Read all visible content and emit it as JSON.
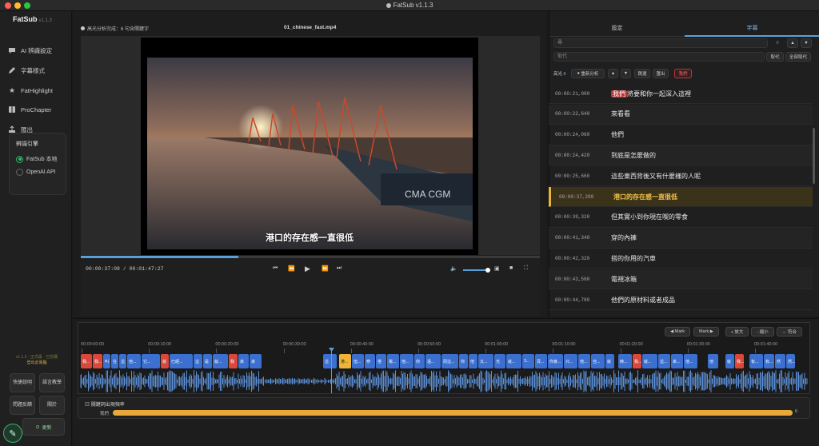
{
  "window": {
    "title": "FatSub v1.1.3"
  },
  "sidebar": {
    "app_name": "FatSub",
    "app_version": "v1.1.3",
    "items": [
      {
        "label": "AI 辨識設定",
        "icon": "chat-icon"
      },
      {
        "label": "字幕樣式",
        "icon": "pen-icon"
      },
      {
        "label": "FatHighlight",
        "icon": "star-icon"
      },
      {
        "label": "ProChapter",
        "icon": "book-icon"
      },
      {
        "label": "匯出",
        "icon": "export-icon"
      }
    ],
    "engine": {
      "heading": "辨識引擎",
      "options": [
        {
          "label": "FatSub 本地",
          "selected": true
        },
        {
          "label": "OpenAI API",
          "selected": false
        }
      ]
    },
    "version_line1": "v1.1.3 · 正式版 · 已授權",
    "version_line2": "登出此電腦",
    "buttons": [
      "快捷說明",
      "語言教學",
      "問題反饋",
      "關於"
    ],
    "update_label": "更新"
  },
  "video": {
    "status": "高光分析完成：6 句含關鍵字",
    "filename": "01_chinese_fast.mp4",
    "subtitle": "港口的存在感一直很低",
    "time_display": "00:00:37:08 / 00:01:47:27",
    "progress": 0.344,
    "volume": 0.9
  },
  "right_panel": {
    "tabs": [
      {
        "label": "設定",
        "active": false
      },
      {
        "label": "字幕",
        "active": true
      }
    ],
    "find_placeholder": "尋",
    "replace_placeholder": "取代",
    "match_count": "0",
    "replace_label": "取代",
    "replace_all_label": "全部取代",
    "highlight_label": "高光",
    "highlight_count": "6",
    "reanalyze_label": "重新分析",
    "prev_label": "▲",
    "next_label": "▼",
    "jump_label": "跳選",
    "exit_label": "匯出",
    "keyword_chip": "我們",
    "rows": [
      {
        "time": "00:00:21,000",
        "pre": "",
        "keyword": "我們",
        "text": "將要和你一起深入這裡",
        "active": false
      },
      {
        "time": "00:00:22,640",
        "pre": "",
        "keyword": "",
        "text": "來看看",
        "active": false
      },
      {
        "time": "00:00:24,060",
        "pre": "",
        "keyword": "",
        "text": "他們",
        "active": false
      },
      {
        "time": "00:00:24,420",
        "pre": "",
        "keyword": "",
        "text": "到底是怎麼做的",
        "active": false
      },
      {
        "time": "00:00:25,660",
        "pre": "",
        "keyword": "",
        "text": "這些東西背後又有什麼樣的人呢",
        "active": false
      },
      {
        "time": "00:00:37,280",
        "pre": "",
        "keyword": "",
        "text": "港口的存在感一直很低",
        "active": true
      },
      {
        "time": "00:00:39,320",
        "pre": "",
        "keyword": "",
        "text": "但其實小到你現在喫的零食",
        "active": false
      },
      {
        "time": "00:00:41,340",
        "pre": "",
        "keyword": "",
        "text": "穿的內褲",
        "active": false
      },
      {
        "time": "00:00:42,320",
        "pre": "",
        "keyword": "",
        "text": "搭的你用的汽車",
        "active": false
      },
      {
        "time": "00:00:43,560",
        "pre": "",
        "keyword": "",
        "text": "電視冰箱",
        "active": false
      },
      {
        "time": "00:00:44,780",
        "pre": "",
        "keyword": "",
        "text": "他們的原材料或者成品",
        "active": false
      }
    ]
  },
  "timeline": {
    "buttons": [
      "◀ Mark",
      "Mark ▶",
      "+ 放大",
      "- 縮小",
      "⇔ 符合"
    ],
    "ticks": [
      "00:00:00:00",
      "00:00:10:00",
      "00:00:20:00",
      "00:00:30:00",
      "00:00:40:00",
      "00:00:50:00",
      "00:01:00:00",
      "00:01:10:00",
      "00:01:20:00",
      "00:01:30:00",
      "00:01:40:00"
    ],
    "segments": [
      {
        "text": "我...",
        "color": "#d9483b"
      },
      {
        "text": "我...",
        "color": "#d9483b"
      },
      {
        "text": "叫",
        "color": "#3b6fd0"
      },
      {
        "text": "在",
        "color": "#3b6fd0"
      },
      {
        "text": "這",
        "color": "#3b6fd0"
      },
      {
        "text": "他...",
        "color": "#3b6fd0"
      },
      {
        "text": "它...",
        "color": "#3b6fd0"
      },
      {
        "text": "就",
        "color": "#d9483b"
      },
      {
        "text": "已經...",
        "color": "#3b6fd0"
      },
      {
        "text": "這",
        "color": "#3b6fd0"
      },
      {
        "text": "是",
        "color": "#3b6fd0"
      },
      {
        "text": "就...",
        "color": "#3b6fd0"
      },
      {
        "text": "我",
        "color": "#d9483b"
      },
      {
        "text": "來",
        "color": "#3b6fd0"
      },
      {
        "text": "來",
        "color": "#3b6fd0"
      },
      {
        "text": "這",
        "color": "#3b6fd0"
      },
      {
        "text": "港...",
        "color": "#f0b43a"
      },
      {
        "text": "但...",
        "color": "#3b6fd0"
      },
      {
        "text": "穿",
        "color": "#3b6fd0"
      },
      {
        "text": "搭",
        "color": "#3b6fd0"
      },
      {
        "text": "電...",
        "color": "#3b6fd0"
      },
      {
        "text": "他...",
        "color": "#3b6fd0"
      },
      {
        "text": "你",
        "color": "#3b6fd0"
      },
      {
        "text": "遠...",
        "color": "#3b6fd0"
      },
      {
        "text": "而這...",
        "color": "#3b6fd0"
      },
      {
        "text": "你",
        "color": "#3b6fd0"
      },
      {
        "text": "他",
        "color": "#3b6fd0"
      },
      {
        "text": "又...",
        "color": "#3b6fd0"
      },
      {
        "text": "光",
        "color": "#3b6fd0"
      },
      {
        "text": "就...",
        "color": "#3b6fd0"
      },
      {
        "text": "3...",
        "color": "#3b6fd0"
      },
      {
        "text": "頁...",
        "color": "#3b6fd0"
      },
      {
        "text": "你會...",
        "color": "#3b6fd0"
      },
      {
        "text": "只...",
        "color": "#3b6fd0"
      },
      {
        "text": "他...",
        "color": "#3b6fd0"
      },
      {
        "text": "自...",
        "color": "#3b6fd0"
      },
      {
        "text": "就",
        "color": "#3b6fd0"
      },
      {
        "text": "時...",
        "color": "#3b6fd0"
      },
      {
        "text": "我...",
        "color": "#d9483b"
      },
      {
        "text": "就...",
        "color": "#3b6fd0"
      },
      {
        "text": "這...",
        "color": "#3b6fd0"
      },
      {
        "text": "來...",
        "color": "#3b6fd0"
      },
      {
        "text": "他...",
        "color": "#3b6fd0"
      },
      {
        "text": "他",
        "color": "#3b6fd0"
      },
      {
        "text": "就",
        "color": "#3b6fd0"
      },
      {
        "text": "我...",
        "color": "#d9483b"
      },
      {
        "text": "有...",
        "color": "#3b6fd0"
      },
      {
        "text": "有...",
        "color": "#3b6fd0"
      },
      {
        "text": "然",
        "color": "#3b6fd0"
      },
      {
        "text": "然...",
        "color": "#3b6fd0"
      }
    ],
    "keyword_title": "關鍵詞出現頻率",
    "keyword": "我們",
    "keyword_count": "6",
    "keyword_fraction": 1.0
  },
  "colors": {
    "accent": "#5aa0d8",
    "highlight": "#e8b43a",
    "keyword": "#b8383a",
    "success": "#3db46d"
  }
}
